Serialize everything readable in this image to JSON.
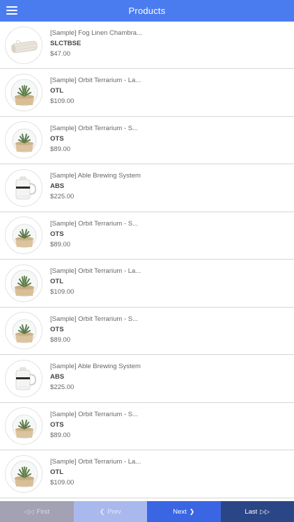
{
  "header": {
    "title": "Products",
    "menu_icon": "hamburger-menu-icon"
  },
  "products": [
    {
      "name": "[Sample] Fog Linen Chambra...",
      "sku": "SLCTBSE",
      "price": "$47.00",
      "image": "towel"
    },
    {
      "name": "[Sample] Orbit Terrarium - La...",
      "sku": "OTL",
      "price": "$109.00",
      "image": "terrarium-large"
    },
    {
      "name": "[Sample] Orbit Terrarium - S...",
      "sku": "OTS",
      "price": "$89.00",
      "image": "terrarium-small"
    },
    {
      "name": "[Sample] Able Brewing System",
      "sku": "ABS",
      "price": "$225.00",
      "image": "brewer"
    },
    {
      "name": "[Sample] Orbit Terrarium - S...",
      "sku": "OTS",
      "price": "$89.00",
      "image": "terrarium-small"
    },
    {
      "name": "[Sample] Orbit Terrarium - La...",
      "sku": "OTL",
      "price": "$109.00",
      "image": "terrarium-large"
    },
    {
      "name": "[Sample] Orbit Terrarium - S...",
      "sku": "OTS",
      "price": "$89.00",
      "image": "terrarium-small"
    },
    {
      "name": "[Sample] Able Brewing System",
      "sku": "ABS",
      "price": "$225.00",
      "image": "brewer"
    },
    {
      "name": "[Sample] Orbit Terrarium - S...",
      "sku": "OTS",
      "price": "$89.00",
      "image": "terrarium-small"
    },
    {
      "name": "[Sample] Orbit Terrarium - La...",
      "sku": "OTL",
      "price": "$109.00",
      "image": "terrarium-large"
    }
  ],
  "pager": {
    "first": {
      "label": "First",
      "icon": "double-chevron-left-icon"
    },
    "prev": {
      "label": "Prev",
      "icon": "chevron-left-icon"
    },
    "next": {
      "label": "Next",
      "icon": "chevron-right-icon"
    },
    "last": {
      "label": "Last",
      "icon": "double-chevron-right-icon"
    }
  },
  "colors": {
    "header": "#4a7cf0",
    "first_bg": "#a2a2b4",
    "prev_bg": "#a9b9ee",
    "next_bg": "#3b66e3",
    "last_bg": "#2b4686"
  }
}
